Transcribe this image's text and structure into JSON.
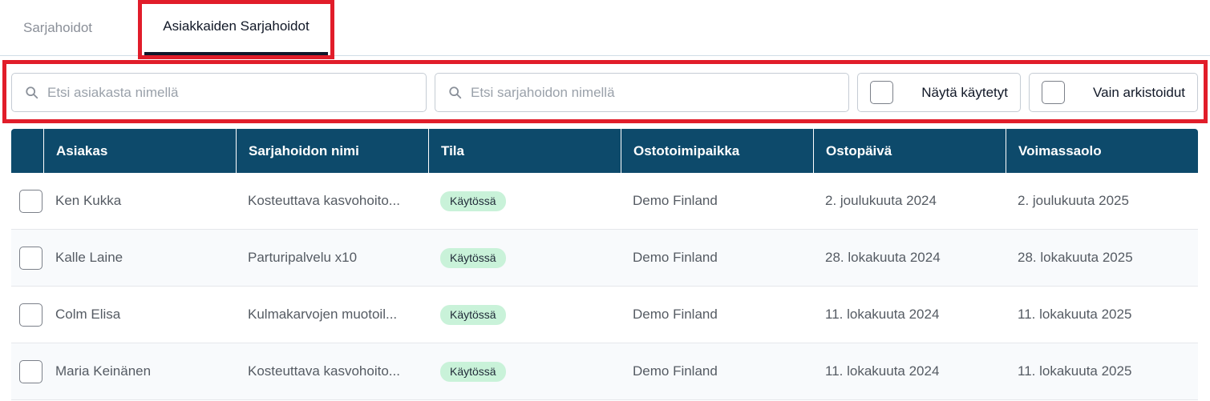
{
  "tabs": [
    {
      "label": "Sarjahoidot",
      "active": false
    },
    {
      "label": "Asiakkaiden Sarjahoidot",
      "active": true
    }
  ],
  "filters": {
    "customer_search_placeholder": "Etsi asiakasta nimellä",
    "series_search_placeholder": "Etsi sarjahoidon nimellä",
    "show_used_label": "Näytä käytetyt",
    "only_archived_label": "Vain arkistoidut"
  },
  "table": {
    "columns": [
      "Asiakas",
      "Sarjahoidon nimi",
      "Tila",
      "Ostotoimipaikka",
      "Ostopäivä",
      "Voimassaolo"
    ],
    "rows": [
      {
        "customer": "Ken Kukka",
        "name": "Kosteuttava kasvohoito...",
        "status": "Käytössä",
        "location": "Demo Finland",
        "purchase_date": "2. joulukuuta 2024",
        "valid_until": "2. joulukuuta 2025"
      },
      {
        "customer": "Kalle Laine",
        "name": "Parturipalvelu x10",
        "status": "Käytössä",
        "location": "Demo Finland",
        "purchase_date": "28. lokakuuta 2024",
        "valid_until": "28. lokakuuta 2025"
      },
      {
        "customer": "Colm Elisa",
        "name": "Kulmakarvojen muotoil...",
        "status": "Käytössä",
        "location": "Demo Finland",
        "purchase_date": "11. lokakuuta 2024",
        "valid_until": "11. lokakuuta 2025"
      },
      {
        "customer": "Maria Keinänen",
        "name": "Kosteuttava kasvohoito...",
        "status": "Käytössä",
        "location": "Demo Finland",
        "purchase_date": "11. lokakuuta 2024",
        "valid_until": "11. lokakuuta 2025"
      }
    ]
  },
  "colors": {
    "header_bg": "#0d4a6b",
    "highlight": "#e11d2a",
    "status_badge_bg": "#c9f2d9"
  },
  "icons": {
    "search": "search-icon"
  }
}
